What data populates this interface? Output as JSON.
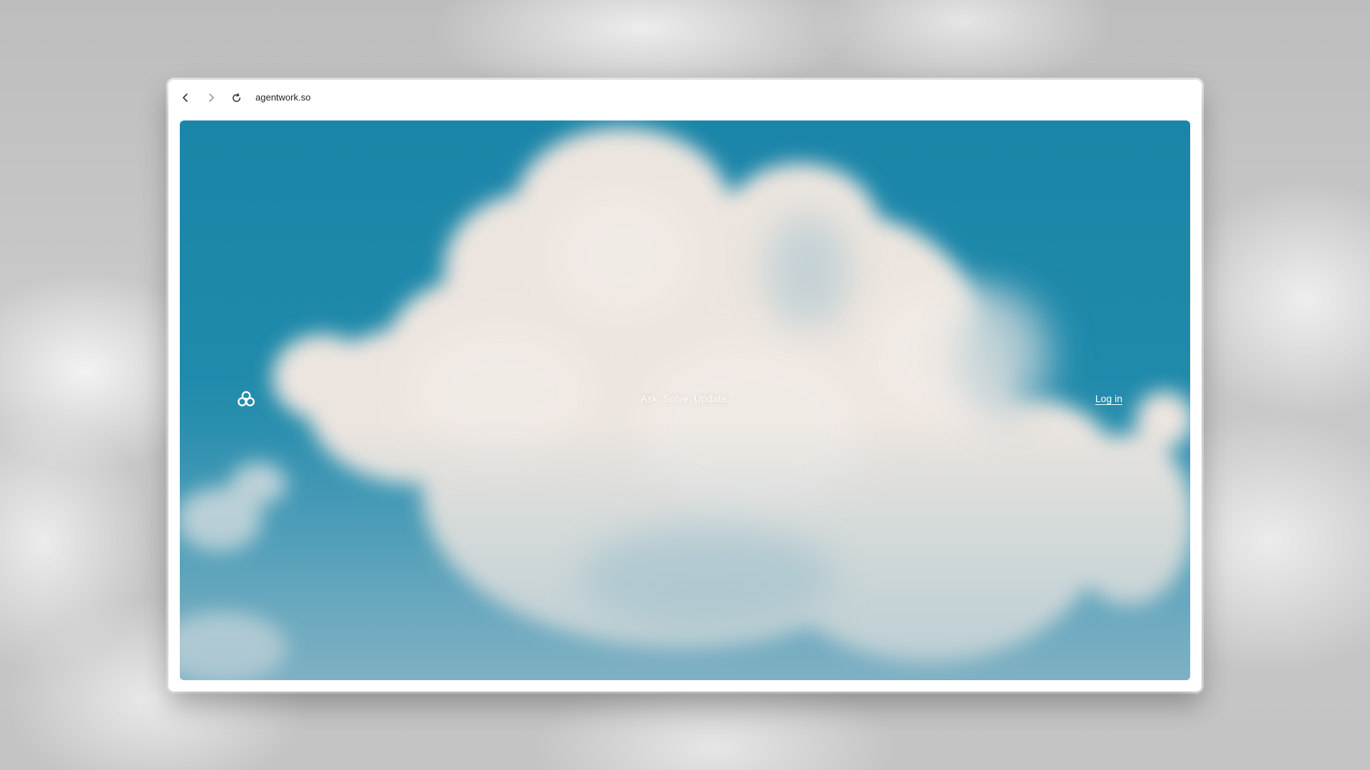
{
  "browser": {
    "url": "agentwork.so",
    "nav": {
      "back_icon": "chevron-left-icon",
      "forward_icon": "chevron-right-icon",
      "reload_icon": "reload-icon"
    }
  },
  "page": {
    "logo_icon": "three-circles-logo-icon",
    "tagline": "Ask. Solve. Update.",
    "login_label": "Log in"
  },
  "colors": {
    "sky": "#1b85a9",
    "cloud": "#ece6e0",
    "text": "#ffffff"
  }
}
